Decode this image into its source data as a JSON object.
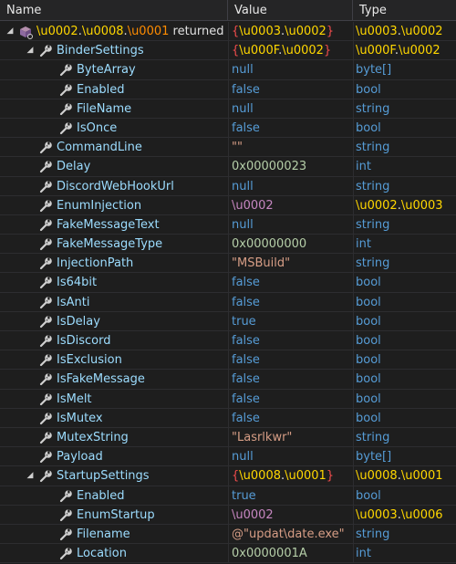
{
  "columns": {
    "name": "Name",
    "value": "Value",
    "type": "Type"
  },
  "colors": {
    "background": "#1e1e1e",
    "name_color": "#9cdcfe",
    "string_color": "#d69d85",
    "keyword_color": "#569cd6",
    "number_color": "#b5cea8",
    "obfuscated_name_color": "#dcdcaa",
    "obfuscated_enum_color": "#c586c0",
    "brace_color": "#f14c4c"
  },
  "rows": [
    {
      "depth": 0,
      "expander": "◢",
      "icon": "returned-value-icon",
      "name_parts": [
        [
          "\\u0002",
          "y"
        ],
        [
          ".",
          "w"
        ],
        [
          "\\u0008",
          "y"
        ],
        [
          ".",
          "w"
        ],
        [
          "\\u0001",
          "o"
        ],
        [
          " returned",
          "w"
        ]
      ],
      "value_parts": [
        [
          "{",
          "r"
        ],
        [
          "\\u0003",
          "y"
        ],
        [
          ".",
          "w"
        ],
        [
          "\\u0002",
          "y"
        ],
        [
          "}",
          "r"
        ]
      ],
      "type_parts": [
        [
          "\\u0003",
          "y"
        ],
        [
          ".",
          "w"
        ],
        [
          "\\u0002",
          "y"
        ]
      ]
    },
    {
      "depth": 1,
      "expander": "◢",
      "icon": "property-wrench-icon",
      "name_parts": [
        [
          "BinderSettings",
          "n"
        ]
      ],
      "value_parts": [
        [
          "{",
          "r"
        ],
        [
          "\\u000F",
          "y"
        ],
        [
          ".",
          "w"
        ],
        [
          "\\u0002",
          "y"
        ],
        [
          "}",
          "r"
        ]
      ],
      "type_parts": [
        [
          "\\u000F",
          "y"
        ],
        [
          ".",
          "w"
        ],
        [
          "\\u0002",
          "y"
        ]
      ]
    },
    {
      "depth": 2,
      "icon": "property-wrench-icon",
      "name_parts": [
        [
          "ByteArray",
          "n"
        ]
      ],
      "value_parts": [
        [
          "null",
          "k"
        ]
      ],
      "type_parts": [
        [
          "byte[]",
          "k"
        ]
      ]
    },
    {
      "depth": 2,
      "icon": "property-wrench-icon",
      "name_parts": [
        [
          "Enabled",
          "n"
        ]
      ],
      "value_parts": [
        [
          "false",
          "k"
        ]
      ],
      "type_parts": [
        [
          "bool",
          "k"
        ]
      ]
    },
    {
      "depth": 2,
      "icon": "property-wrench-icon",
      "name_parts": [
        [
          "FileName",
          "n"
        ]
      ],
      "value_parts": [
        [
          "null",
          "k"
        ]
      ],
      "type_parts": [
        [
          "string",
          "k"
        ]
      ]
    },
    {
      "depth": 2,
      "icon": "property-wrench-icon",
      "name_parts": [
        [
          "IsOnce",
          "n"
        ]
      ],
      "value_parts": [
        [
          "false",
          "k"
        ]
      ],
      "type_parts": [
        [
          "bool",
          "k"
        ]
      ]
    },
    {
      "depth": 1,
      "icon": "property-wrench-icon",
      "name_parts": [
        [
          "CommandLine",
          "n"
        ]
      ],
      "value_parts": [
        [
          "\"\"",
          "s"
        ]
      ],
      "type_parts": [
        [
          "string",
          "k"
        ]
      ]
    },
    {
      "depth": 1,
      "icon": "property-wrench-icon",
      "name_parts": [
        [
          "Delay",
          "n"
        ]
      ],
      "value_parts": [
        [
          "0x00000023",
          "num"
        ]
      ],
      "type_parts": [
        [
          "int",
          "k"
        ]
      ]
    },
    {
      "depth": 1,
      "icon": "property-wrench-icon",
      "name_parts": [
        [
          "DiscordWebHookUrl",
          "n"
        ]
      ],
      "value_parts": [
        [
          "null",
          "k"
        ]
      ],
      "type_parts": [
        [
          "string",
          "k"
        ]
      ]
    },
    {
      "depth": 1,
      "icon": "property-wrench-icon",
      "name_parts": [
        [
          "EnumInjection",
          "n"
        ]
      ],
      "value_parts": [
        [
          "\\u0002",
          "p"
        ]
      ],
      "type_parts": [
        [
          "\\u0002",
          "y"
        ],
        [
          ".",
          "w"
        ],
        [
          "\\u0003",
          "y"
        ]
      ]
    },
    {
      "depth": 1,
      "icon": "property-wrench-icon",
      "name_parts": [
        [
          "FakeMessageText",
          "n"
        ]
      ],
      "value_parts": [
        [
          "null",
          "k"
        ]
      ],
      "type_parts": [
        [
          "string",
          "k"
        ]
      ]
    },
    {
      "depth": 1,
      "icon": "property-wrench-icon",
      "name_parts": [
        [
          "FakeMessageType",
          "n"
        ]
      ],
      "value_parts": [
        [
          "0x00000000",
          "num"
        ]
      ],
      "type_parts": [
        [
          "int",
          "k"
        ]
      ]
    },
    {
      "depth": 1,
      "icon": "property-wrench-icon",
      "name_parts": [
        [
          "InjectionPath",
          "n"
        ]
      ],
      "value_parts": [
        [
          "\"MSBuild\"",
          "s"
        ]
      ],
      "type_parts": [
        [
          "string",
          "k"
        ]
      ]
    },
    {
      "depth": 1,
      "icon": "property-wrench-icon",
      "name_parts": [
        [
          "Is64bit",
          "n"
        ]
      ],
      "value_parts": [
        [
          "false",
          "k"
        ]
      ],
      "type_parts": [
        [
          "bool",
          "k"
        ]
      ]
    },
    {
      "depth": 1,
      "icon": "property-wrench-icon",
      "name_parts": [
        [
          "IsAnti",
          "n"
        ]
      ],
      "value_parts": [
        [
          "false",
          "k"
        ]
      ],
      "type_parts": [
        [
          "bool",
          "k"
        ]
      ]
    },
    {
      "depth": 1,
      "icon": "property-wrench-icon",
      "name_parts": [
        [
          "IsDelay",
          "n"
        ]
      ],
      "value_parts": [
        [
          "true",
          "k"
        ]
      ],
      "type_parts": [
        [
          "bool",
          "k"
        ]
      ]
    },
    {
      "depth": 1,
      "icon": "property-wrench-icon",
      "name_parts": [
        [
          "IsDiscord",
          "n"
        ]
      ],
      "value_parts": [
        [
          "false",
          "k"
        ]
      ],
      "type_parts": [
        [
          "bool",
          "k"
        ]
      ]
    },
    {
      "depth": 1,
      "icon": "property-wrench-icon",
      "name_parts": [
        [
          "IsExclusion",
          "n"
        ]
      ],
      "value_parts": [
        [
          "false",
          "k"
        ]
      ],
      "type_parts": [
        [
          "bool",
          "k"
        ]
      ]
    },
    {
      "depth": 1,
      "icon": "property-wrench-icon",
      "name_parts": [
        [
          "IsFakeMessage",
          "n"
        ]
      ],
      "value_parts": [
        [
          "false",
          "k"
        ]
      ],
      "type_parts": [
        [
          "bool",
          "k"
        ]
      ]
    },
    {
      "depth": 1,
      "icon": "property-wrench-icon",
      "name_parts": [
        [
          "IsMelt",
          "n"
        ]
      ],
      "value_parts": [
        [
          "false",
          "k"
        ]
      ],
      "type_parts": [
        [
          "bool",
          "k"
        ]
      ]
    },
    {
      "depth": 1,
      "icon": "property-wrench-icon",
      "name_parts": [
        [
          "IsMutex",
          "n"
        ]
      ],
      "value_parts": [
        [
          "false",
          "k"
        ]
      ],
      "type_parts": [
        [
          "bool",
          "k"
        ]
      ]
    },
    {
      "depth": 1,
      "icon": "property-wrench-icon",
      "name_parts": [
        [
          "MutexString",
          "n"
        ]
      ],
      "value_parts": [
        [
          "\"Lasrlkwr\"",
          "s"
        ]
      ],
      "type_parts": [
        [
          "string",
          "k"
        ]
      ]
    },
    {
      "depth": 1,
      "icon": "property-wrench-icon",
      "name_parts": [
        [
          "Payload",
          "n"
        ]
      ],
      "value_parts": [
        [
          "null",
          "k"
        ]
      ],
      "type_parts": [
        [
          "byte[]",
          "k"
        ]
      ]
    },
    {
      "depth": 1,
      "expander": "◢",
      "icon": "property-wrench-icon",
      "name_parts": [
        [
          "StartupSettings",
          "n"
        ]
      ],
      "value_parts": [
        [
          "{",
          "r"
        ],
        [
          "\\u0008",
          "y"
        ],
        [
          ".",
          "w"
        ],
        [
          "\\u0001",
          "y"
        ],
        [
          "}",
          "r"
        ]
      ],
      "type_parts": [
        [
          "\\u0008",
          "y"
        ],
        [
          ".",
          "w"
        ],
        [
          "\\u0001",
          "y"
        ]
      ]
    },
    {
      "depth": 2,
      "icon": "property-wrench-icon",
      "name_parts": [
        [
          "Enabled",
          "n"
        ]
      ],
      "value_parts": [
        [
          "true",
          "k"
        ]
      ],
      "type_parts": [
        [
          "bool",
          "k"
        ]
      ]
    },
    {
      "depth": 2,
      "icon": "property-wrench-icon",
      "name_parts": [
        [
          "EnumStartup",
          "n"
        ]
      ],
      "value_parts": [
        [
          "\\u0002",
          "p"
        ]
      ],
      "type_parts": [
        [
          "\\u0003",
          "y"
        ],
        [
          ".",
          "w"
        ],
        [
          "\\u0006",
          "y"
        ]
      ]
    },
    {
      "depth": 2,
      "icon": "property-wrench-icon",
      "name_parts": [
        [
          "Filename",
          "n"
        ]
      ],
      "value_parts": [
        [
          "@\"updat\\date.exe\"",
          "s"
        ]
      ],
      "type_parts": [
        [
          "string",
          "k"
        ]
      ]
    },
    {
      "depth": 2,
      "icon": "property-wrench-icon",
      "name_parts": [
        [
          "Location",
          "n"
        ]
      ],
      "value_parts": [
        [
          "0x0000001A",
          "num"
        ]
      ],
      "type_parts": [
        [
          "int",
          "k"
        ]
      ]
    }
  ]
}
